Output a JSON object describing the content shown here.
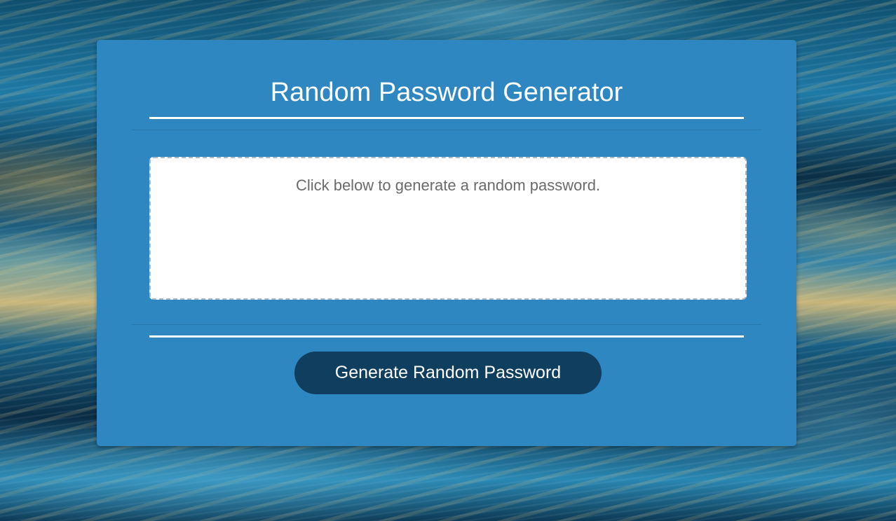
{
  "card": {
    "title": "Random Password Generator",
    "password_placeholder": "Click below to generate a random password.",
    "generate_button_label": "Generate Random Password"
  },
  "colors": {
    "card_background": "#2e87c0",
    "button_background": "#0f3e5e",
    "text_light": "#ffffff"
  }
}
